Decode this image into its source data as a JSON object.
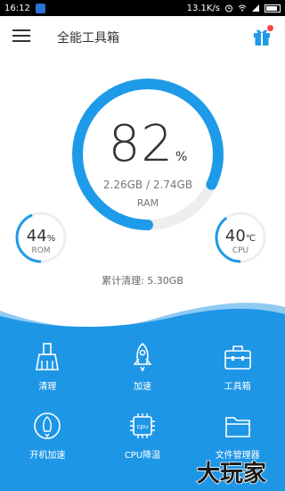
{
  "status_bar": {
    "time": "16:12",
    "speed": "13.1K/s"
  },
  "app": {
    "title": "全能工具箱"
  },
  "ram": {
    "percent": 82,
    "percent_text": "82",
    "unit": "%",
    "used_total": "2.26GB / 2.74GB",
    "label": "RAM"
  },
  "rom": {
    "percent": 44,
    "value": "44",
    "unit": "%",
    "label": "ROM"
  },
  "cpu": {
    "temperature": 40,
    "value": "40",
    "unit": "℃",
    "label": "CPU"
  },
  "cleaned": {
    "text": "累计清理: 5.30GB"
  },
  "tools": [
    {
      "label": "清理",
      "icon": "broom-icon"
    },
    {
      "label": "加速",
      "icon": "rocket-icon"
    },
    {
      "label": "工具箱",
      "icon": "toolbox-icon"
    },
    {
      "label": "开机加速",
      "icon": "power-boost-icon"
    },
    {
      "label": "CPU降温",
      "icon": "cpu-chip-icon"
    },
    {
      "label": "文件管理器",
      "icon": "folder-icon"
    }
  ],
  "chip_text": "cpu",
  "watermark": {
    "text": "大玩家"
  },
  "colors": {
    "accent": "#1e9be8",
    "track": "#eeeeee",
    "panel": "#1e96e6",
    "badge": "#ff4444",
    "watermark": "#1a1a1a"
  }
}
